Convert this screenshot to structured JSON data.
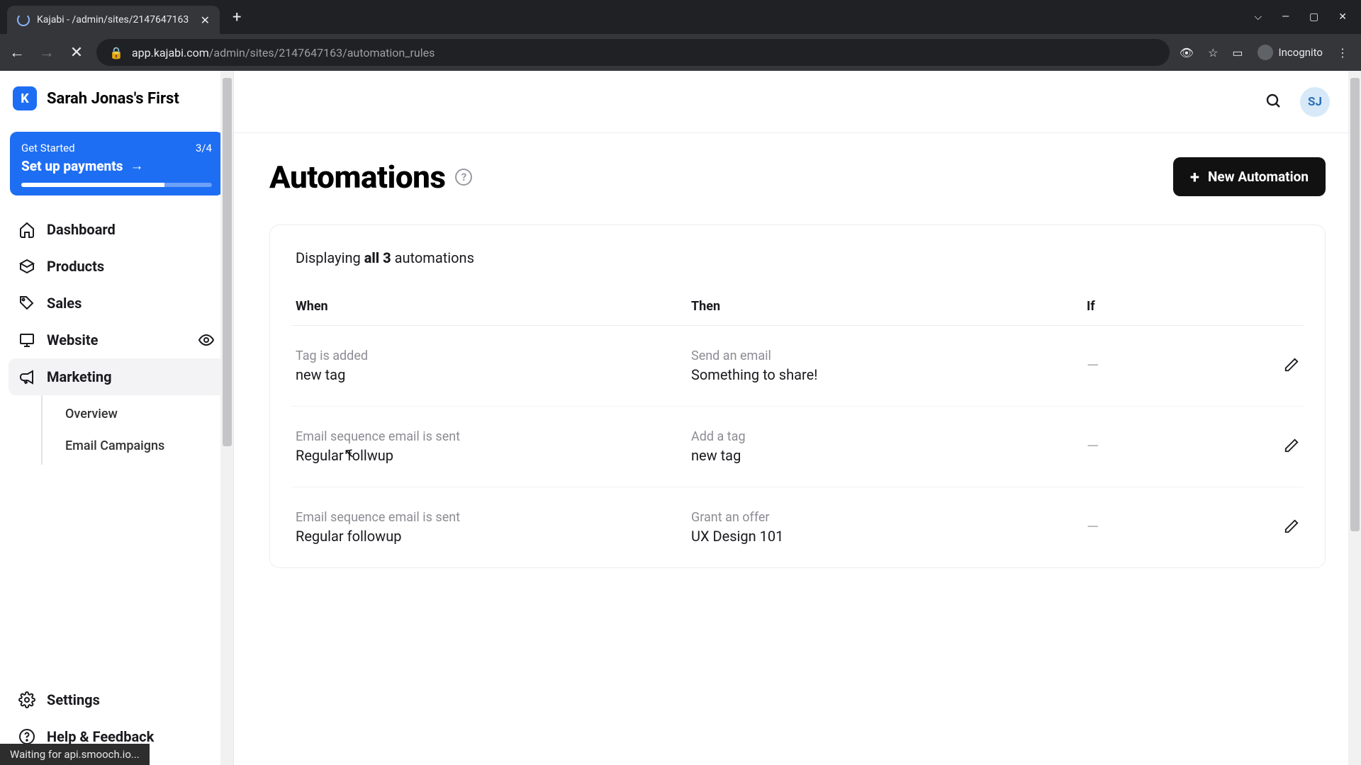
{
  "browser": {
    "tab_title": "Kajabi - /admin/sites/2147647163",
    "url_host": "app.kajabi.com",
    "url_path": "/admin/sites/2147647163/automation_rules",
    "incognito_label": "Incognito"
  },
  "brand": {
    "logo_letter": "K",
    "site_name": "Sarah Jonas's First"
  },
  "get_started": {
    "label": "Get Started",
    "progress_text": "3/4",
    "action": "Set up payments",
    "progress_percent": 75
  },
  "nav": {
    "dashboard": "Dashboard",
    "products": "Products",
    "sales": "Sales",
    "website": "Website",
    "marketing": "Marketing",
    "settings": "Settings",
    "help": "Help & Feedback"
  },
  "subnav": {
    "overview": "Overview",
    "email_campaigns": "Email Campaigns"
  },
  "topbar": {
    "avatar_initials": "SJ"
  },
  "page": {
    "title": "Automations",
    "new_button": "New Automation",
    "displaying_prefix": "Displaying ",
    "displaying_bold": "all 3",
    "displaying_suffix": " automations",
    "columns": {
      "when": "When",
      "then": "Then",
      "if": "If"
    },
    "rows": [
      {
        "when_label": "Tag is added",
        "when_value": "new tag",
        "then_label": "Send an email",
        "then_value": "Something to share!",
        "if_value": "—"
      },
      {
        "when_label": "Email sequence email is sent",
        "when_value": "Regular follwup",
        "then_label": "Add a tag",
        "then_value": "new tag",
        "if_value": "—"
      },
      {
        "when_label": "Email sequence email is sent",
        "when_value": "Regular followup",
        "then_label": "Grant an offer",
        "then_value": "UX Design 101",
        "if_value": "—"
      }
    ]
  },
  "status_bar": "Waiting for api.smooch.io..."
}
